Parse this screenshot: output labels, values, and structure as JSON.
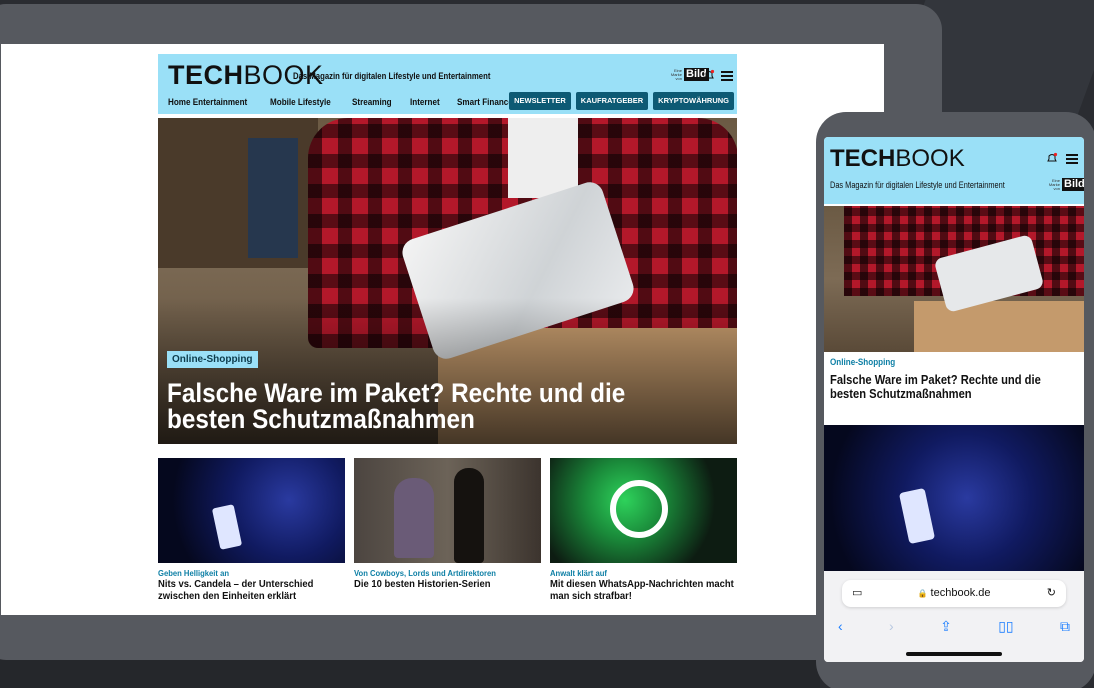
{
  "tablet": {
    "logo_bold": "TECH",
    "logo_light": "BOOK",
    "tagline": "Das Magazin für digitalen Lifestyle und Entertainment",
    "brand_small": "Eine Marke von",
    "brand_name": "Bild",
    "nav": [
      "Home Entertainment",
      "Mobile Lifestyle",
      "Streaming",
      "Internet",
      "Smart Finance"
    ],
    "buttons": [
      "NEWSLETTER",
      "KAUFRATGEBER",
      "KRYPTOWÄHRUNG"
    ],
    "hero": {
      "tag": "Online-Shopping",
      "title": "Falsche Ware im Paket? Rechte und die besten Schutzmaßnahmen"
    },
    "cards": [
      {
        "tag": "Geben Helligkeit an",
        "title": "Nits vs. Candela – der Unterschied zwischen den Einheiten erklärt"
      },
      {
        "tag": "Von Cowboys, Lords und Artdirektoren",
        "title": "Die 10 besten Historien-Serien"
      },
      {
        "tag": "Anwalt klärt auf",
        "title": "Mit diesen WhatsApp-Nachrichten macht man sich strafbar!"
      }
    ]
  },
  "phone": {
    "logo_bold": "TECH",
    "logo_light": "BOOK",
    "tagline": "Das Magazin für digitalen Lifestyle und Entertainment",
    "brand_small": "Eine Marke von",
    "brand_name": "Bild",
    "hero": {
      "tag": "Online-Shopping",
      "title": "Falsche Ware im Paket? Rechte und die besten Schutzmaßnahmen"
    },
    "url": "techbook.de"
  },
  "colors": {
    "accent": "#9ae0f7",
    "button": "#0d5a74",
    "tag_text": "#0d7fa5"
  }
}
